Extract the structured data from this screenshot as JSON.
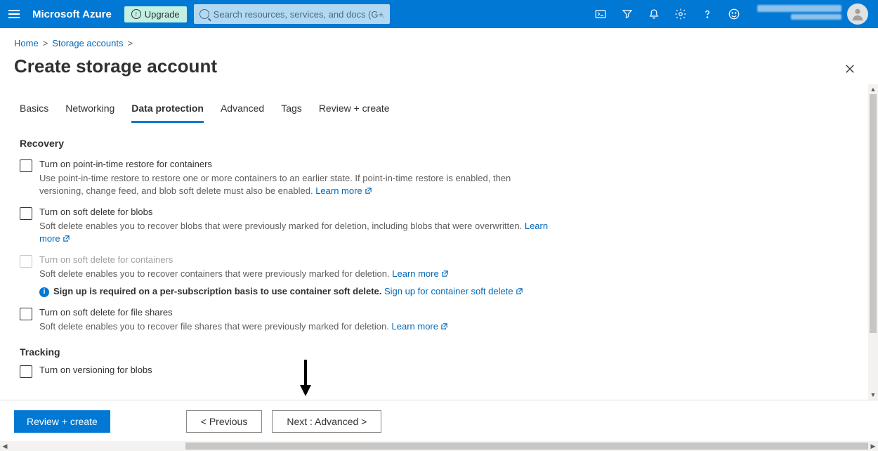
{
  "header": {
    "brand": "Microsoft Azure",
    "upgrade": "Upgrade",
    "search_placeholder": "Search resources, services, and docs (G+/)"
  },
  "breadcrumb": {
    "home": "Home",
    "storage_accounts": "Storage accounts"
  },
  "page_title": "Create storage account",
  "tabs": {
    "basics": "Basics",
    "networking": "Networking",
    "data_protection": "Data protection",
    "advanced": "Advanced",
    "tags": "Tags",
    "review": "Review + create"
  },
  "sections": {
    "recovery": "Recovery",
    "tracking": "Tracking"
  },
  "options": {
    "pit": {
      "label": "Turn on point-in-time restore for containers",
      "desc": "Use point-in-time restore to restore one or more containers to an earlier state. If point-in-time restore is enabled, then versioning, change feed, and blob soft delete must also be enabled.",
      "link": "Learn more"
    },
    "soft_blobs": {
      "label": "Turn on soft delete for blobs",
      "desc": "Soft delete enables you to recover blobs that were previously marked for deletion, including blobs that were overwritten.",
      "link": "Learn more"
    },
    "soft_containers": {
      "label": "Turn on soft delete for containers",
      "desc": "Soft delete enables you to recover containers that were previously marked for deletion.",
      "link": "Learn more",
      "signup_text": "Sign up is required on a per-subscription basis to use container soft delete.",
      "signup_link": "Sign up for container soft delete"
    },
    "soft_files": {
      "label": "Turn on soft delete for file shares",
      "desc": "Soft delete enables you to recover file shares that were previously marked for deletion.",
      "link": "Learn more"
    },
    "versioning": {
      "label": "Turn on versioning for blobs"
    }
  },
  "footer": {
    "review": "Review + create",
    "previous": "< Previous",
    "next": "Next : Advanced >"
  }
}
